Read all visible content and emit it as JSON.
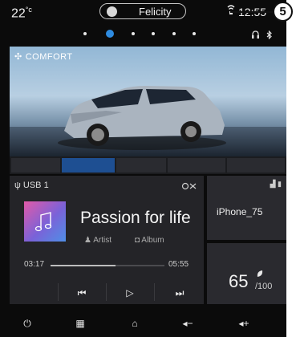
{
  "status_bar": {
    "temperature": "22",
    "temperature_unit": "°c",
    "profile_name": "Felicity",
    "time": "12:55"
  },
  "callout_number": "5",
  "page_dots": {
    "count": 6,
    "active_index": 1,
    "accent": "#2e8be0"
  },
  "comfort_widget": {
    "label": "COMFORT",
    "icon": "fan-icon"
  },
  "media": {
    "source": "USB 1",
    "title": "Passion for life",
    "artist_label": "Artist",
    "album_label": "Album",
    "elapsed": "03:17",
    "total": "05:55",
    "progress_fraction": 0.57
  },
  "phone": {
    "device_name": "iPhone_75"
  },
  "eco": {
    "score": "65",
    "max": "/100"
  },
  "bottom_bar": {
    "icons": [
      "power-icon",
      "apps-grid-icon",
      "home-icon",
      "volume-down-icon",
      "volume-up-icon"
    ]
  }
}
